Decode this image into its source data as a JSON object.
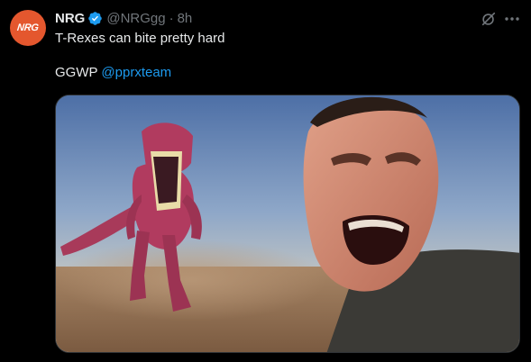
{
  "account": {
    "avatar_text": "NRG",
    "avatar_color": "#e4572e",
    "display_name": "NRG",
    "handle": "@NRGgg",
    "separator": "·",
    "time": "8h",
    "verified_color": "#1d9bf0"
  },
  "tweet": {
    "line1": "T-Rexes can bite pretty hard",
    "line2_prefix": "GGWP ",
    "mention": "@pprxteam"
  },
  "icons": {
    "grok": "grok-icon",
    "more": "more-icon",
    "verified": "verified-badge-icon"
  },
  "colors": {
    "background": "#000000",
    "text": "#e7e9ea",
    "secondary": "#71767b",
    "link": "#1d9bf0"
  }
}
